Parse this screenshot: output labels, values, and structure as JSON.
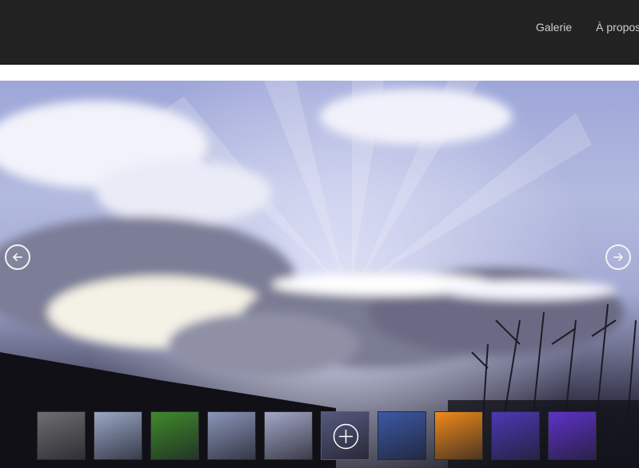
{
  "nav": {
    "items": [
      {
        "label": "Galerie"
      },
      {
        "label": "À propos"
      }
    ]
  },
  "slideshow": {
    "prev_icon": "arrow-left-icon",
    "next_icon": "arrow-right-icon",
    "active_index": 5,
    "thumbnails": [
      {
        "icon": "tree-landscape-thumbnail",
        "color": "#6f6f70"
      },
      {
        "icon": "cloud-pattern-thumbnail",
        "color": "#9aa7c6"
      },
      {
        "icon": "grass-thumbnail",
        "color": "#3f8a2c"
      },
      {
        "icon": "lake-sky-thumbnail",
        "color": "#8b96b9"
      },
      {
        "icon": "sunbeams-thumbnail",
        "color": "#a4a8c8"
      },
      {
        "icon": "zoom-plus-icon",
        "color": "#55597e"
      },
      {
        "icon": "sun-clouds-thumbnail",
        "color": "#3c58a6"
      },
      {
        "icon": "sunset-sea-thumbnail",
        "color": "#f08b1a"
      },
      {
        "icon": "purple-dusk-thumbnail",
        "color": "#4c39b5"
      },
      {
        "icon": "moon-thumbnail",
        "color": "#5e32c9"
      }
    ]
  }
}
